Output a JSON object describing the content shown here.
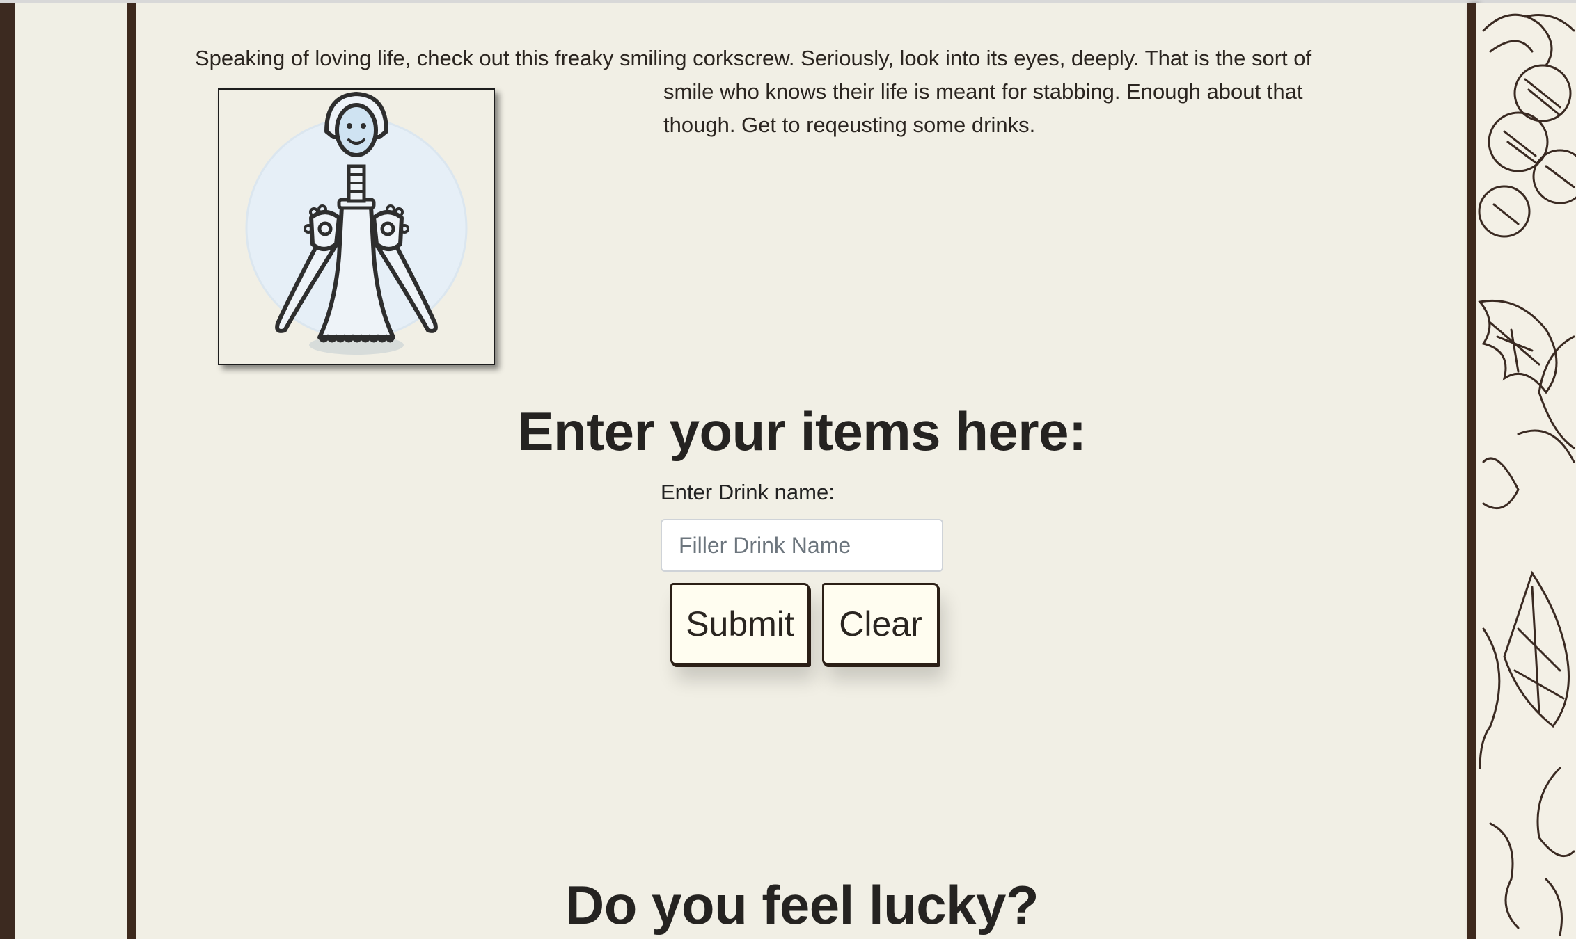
{
  "intro": {
    "line1": "Speaking of loving life, check out this freaky smiling corkscrew. Seriously, look into its eyes, deeply. That is the sort of",
    "rest": "smile who knows their life is meant for stabbing. Enough about that though. Get to reqeusting some drinks."
  },
  "form": {
    "heading": "Enter your items here:",
    "label": "Enter Drink name:",
    "placeholder": "Filler Drink Name",
    "submit_label": "Submit",
    "clear_label": "Clear"
  },
  "lucky": {
    "heading": "Do you feel lucky?"
  },
  "images": {
    "corkscrew": "smiling-corkscrew-illustration",
    "background_pattern": "grapevine-sketch-pattern"
  },
  "colors": {
    "page_bg": "#f1efe5",
    "border_dark": "#3d291d",
    "button_bg": "#fffdf0",
    "corkscrew_fill": "#e6eff7"
  }
}
